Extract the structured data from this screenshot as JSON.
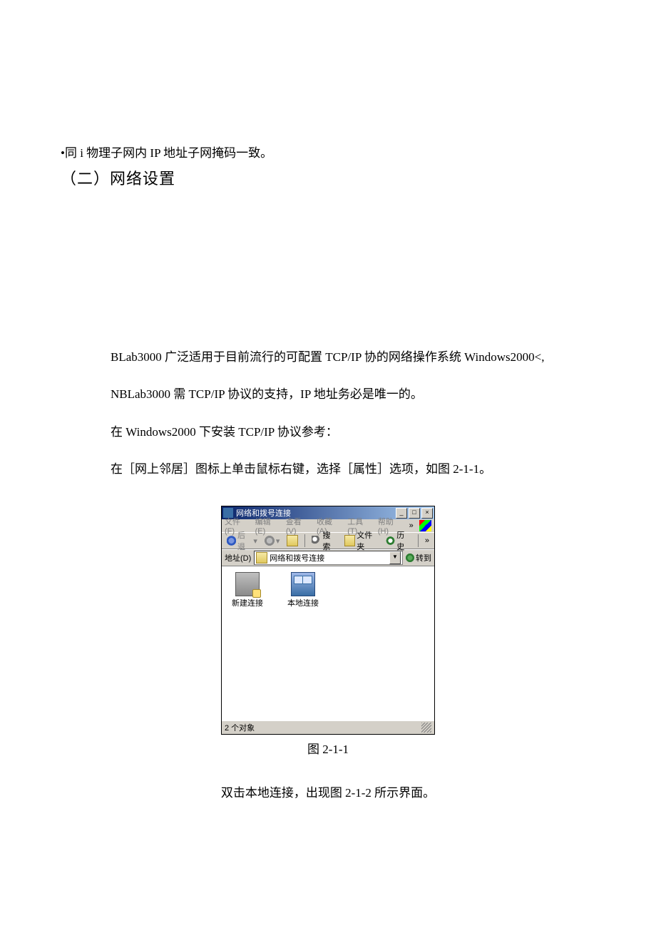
{
  "doc": {
    "bullet": "•同 i 物理子网内 IP 地址子网掩码一致。",
    "heading": "（二）网络设置",
    "p1": "BLab3000 广泛适用于目前流行的可配置 TCP/IP 协的网络操作系统 Windows2000<,",
    "p2": "NBLab3000 需 TCP/IP 协议的支持，IP 地址务必是唯一的。",
    "p3": "在 Windows2000 下安装 TCP/IP 协议参考：",
    "p4": "在［网上邻居］图标上单击鼠标右键，选择［属性］选项，如图 2-1-1。",
    "figcap": "图 2-1-1",
    "p5": "双击本地连接，出现图 2-1-2 所示界面。"
  },
  "win": {
    "title": "网络和拨号连接",
    "menus": {
      "file": "文件(F)",
      "edit": "编辑(E)",
      "view": "查看(V)",
      "fav": "收藏(A)",
      "tools": "工具(T)",
      "help": "帮助(H)",
      "more": "»"
    },
    "toolbar": {
      "back": "后退",
      "search": "搜索",
      "folders": "文件夹",
      "history": "历史",
      "more": "»"
    },
    "address_label": "地址(D)",
    "address_value": "网络和拨号连接",
    "go": "转到",
    "icons": {
      "new": "新建连接",
      "lan": "本地连接"
    },
    "status": "2 个对象",
    "winbtns": {
      "min": "_",
      "max": "□",
      "close": "×"
    }
  }
}
